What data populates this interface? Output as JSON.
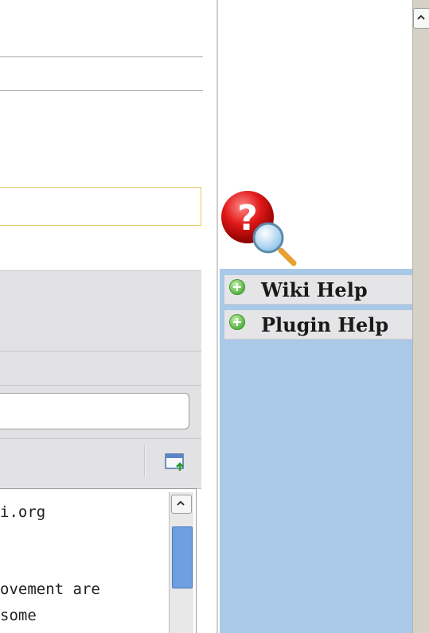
{
  "editor": {
    "text_line1": "i.org",
    "text_line2": "ovement are",
    "text_line3": "some"
  },
  "help": {
    "items": [
      {
        "label": "Wiki Help",
        "icon": "plus-circle-icon"
      },
      {
        "label": "Plugin Help",
        "icon": "plus-circle-icon"
      }
    ],
    "icon": "help-question-magnifier-icon"
  },
  "colors": {
    "help_panel": "#aac8e8",
    "accent_green": "#5cb84a",
    "input_border_yellow": "#e6c86a",
    "scrollbar_thumb": "#6f9fe0"
  }
}
